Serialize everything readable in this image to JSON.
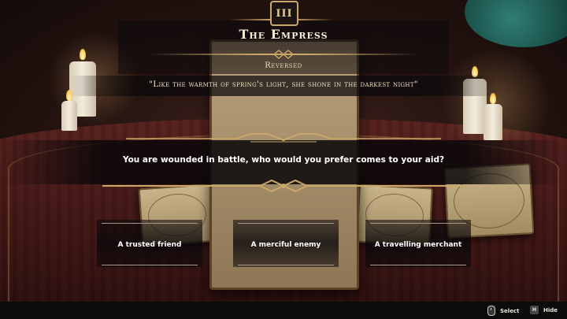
{
  "card": {
    "numeral": "III",
    "title": "The Empress",
    "orientation": "Reversed",
    "quote": "\"Like the warmth of spring's light, she shone in the darkest night\""
  },
  "question": {
    "text": "You are wounded in battle, who would you prefer comes to your aid?"
  },
  "answers": [
    {
      "label": "A trusted friend"
    },
    {
      "label": "A merciful enemy"
    },
    {
      "label": "A travelling merchant"
    }
  ],
  "footer": {
    "select": {
      "icon": "mouse-icon",
      "label": "Select"
    },
    "hide": {
      "icon": "key-icon",
      "key": "H",
      "label": "Hide"
    }
  },
  "colors": {
    "gold": "#c9a86a",
    "text": "#f2e6cc",
    "band": "#0c0b0b"
  }
}
